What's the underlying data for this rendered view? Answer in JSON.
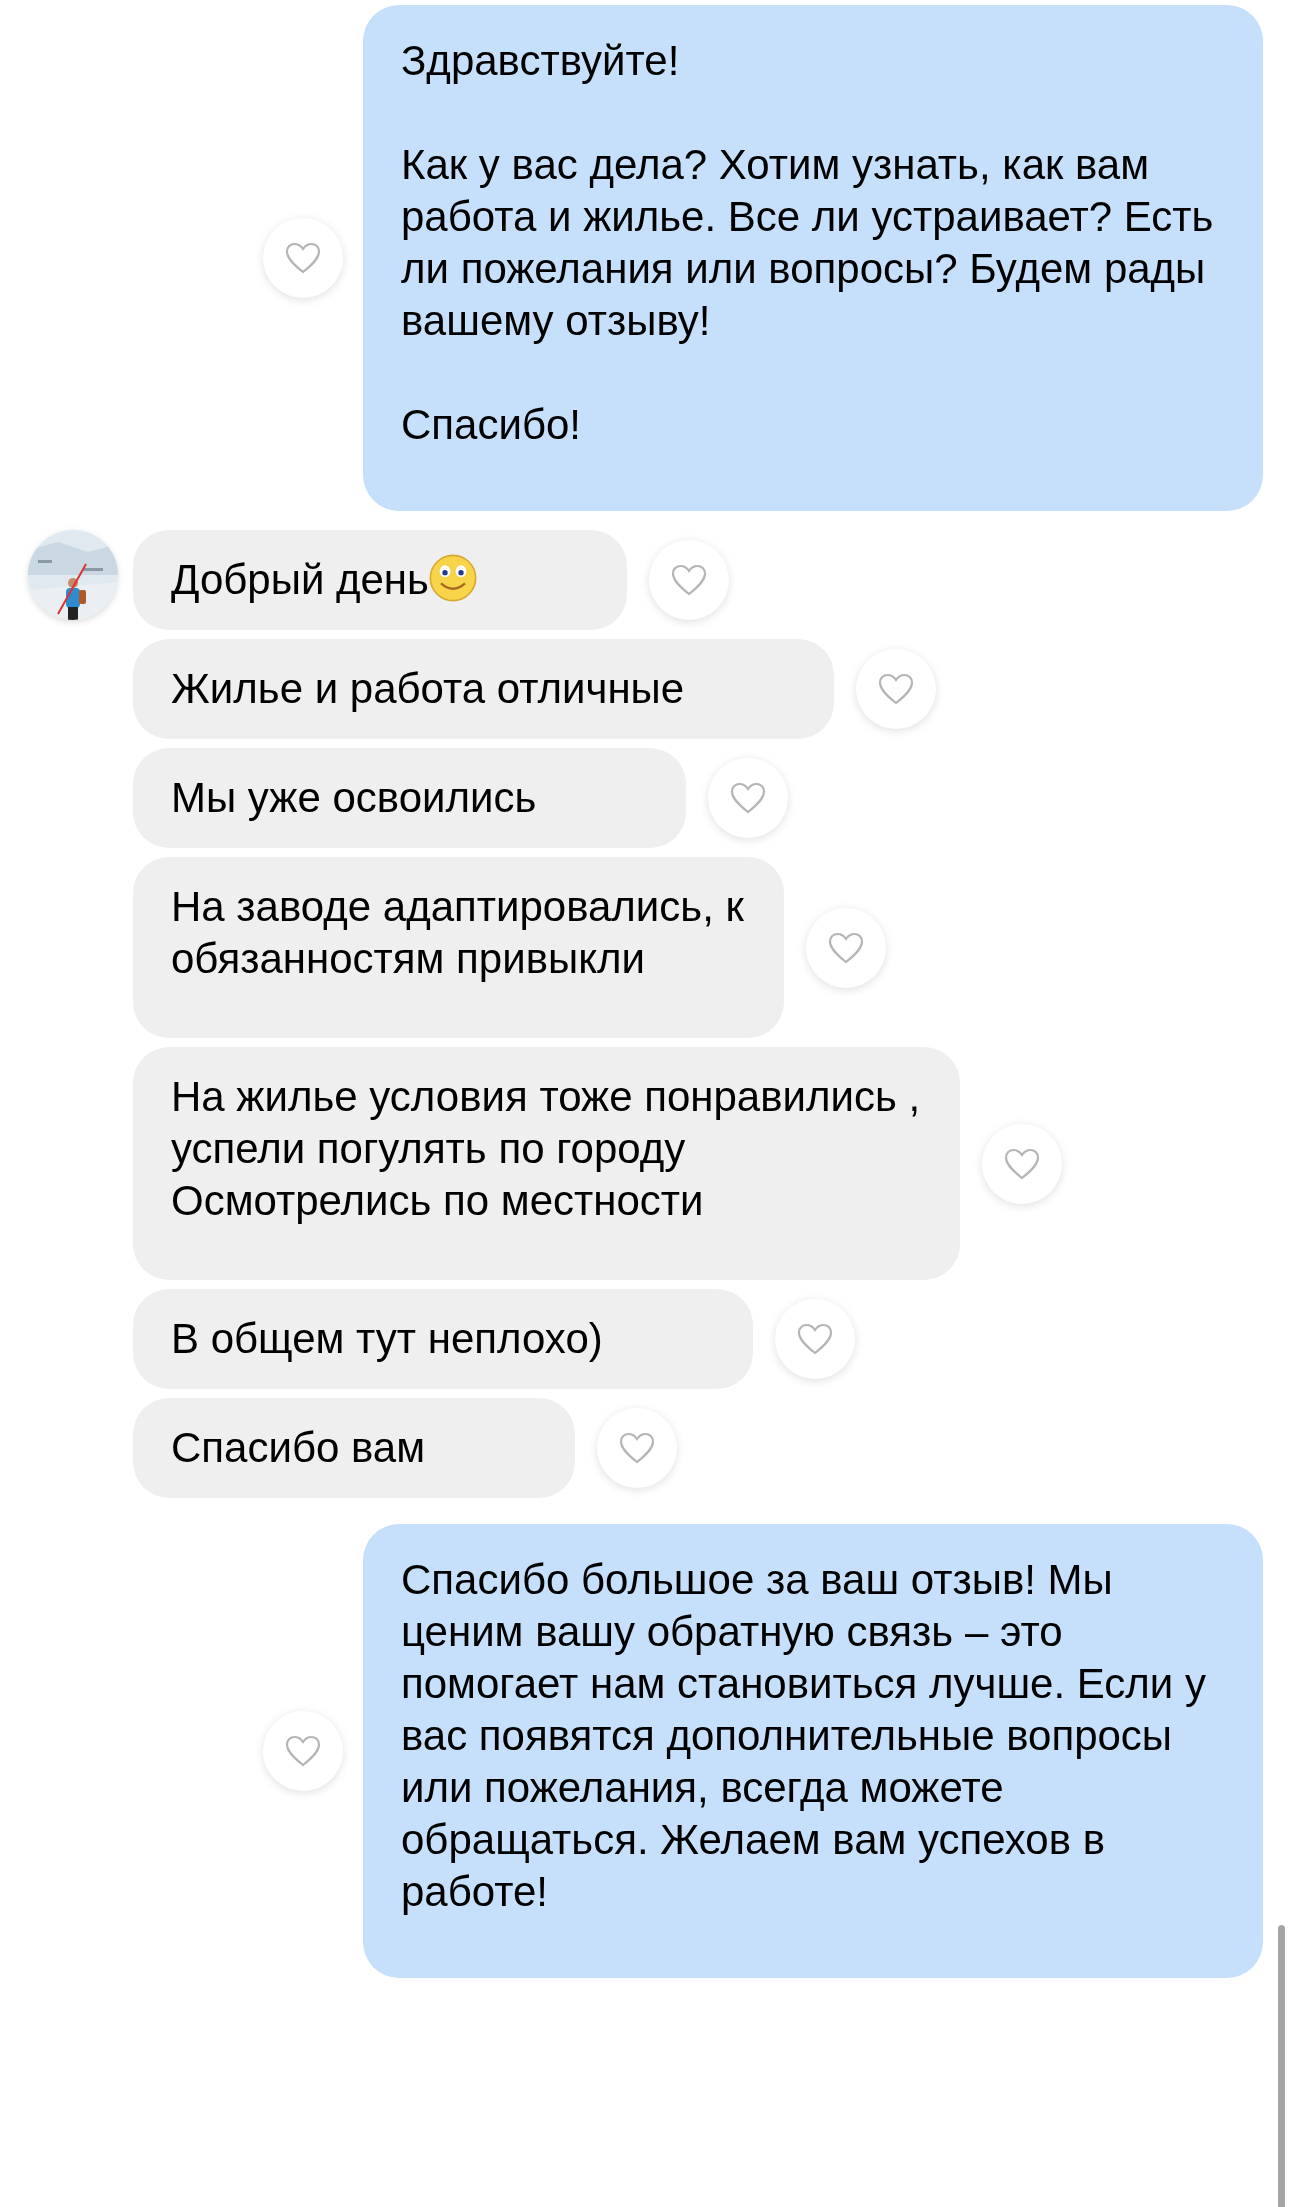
{
  "messages": [
    {
      "kind": "outgoing",
      "text": "Здравствуйте!\n\nКак у вас дела? Хотим узнать, как вам работа и жилье. Все ли устраивает? Есть ли пожелания или вопросы? Будем рады вашему отзыву!\n\nСпасибо!",
      "liked": false
    },
    {
      "kind": "incoming",
      "avatar": true,
      "smiley": true,
      "text": "Добрый день",
      "liked": false
    },
    {
      "kind": "incoming",
      "text": "Жилье и работа отличные",
      "liked": false
    },
    {
      "kind": "incoming",
      "text": "Мы уже освоились",
      "liked": false
    },
    {
      "kind": "incoming",
      "text": "На заводе адаптировались, к\nобязанностям привыкли",
      "liked": false
    },
    {
      "kind": "incoming",
      "text": "На жилье условия тоже понравились ,\nуспели  погулять по городу\nОсмотрелись по местности",
      "liked": false
    },
    {
      "kind": "incoming",
      "text": "В общем тут неплохо)",
      "liked": false
    },
    {
      "kind": "incoming",
      "text": "Спасибо вам",
      "liked": false
    },
    {
      "kind": "outgoing",
      "text": "Спасибо большое за ваш отзыв! Мы ценим вашу обратную связь – это помогает нам становиться лучше. Если у вас появятся дополнительные вопросы или пожелания, всегда можете обращаться. Желаем вам успехов в работе!",
      "liked": false
    }
  ]
}
